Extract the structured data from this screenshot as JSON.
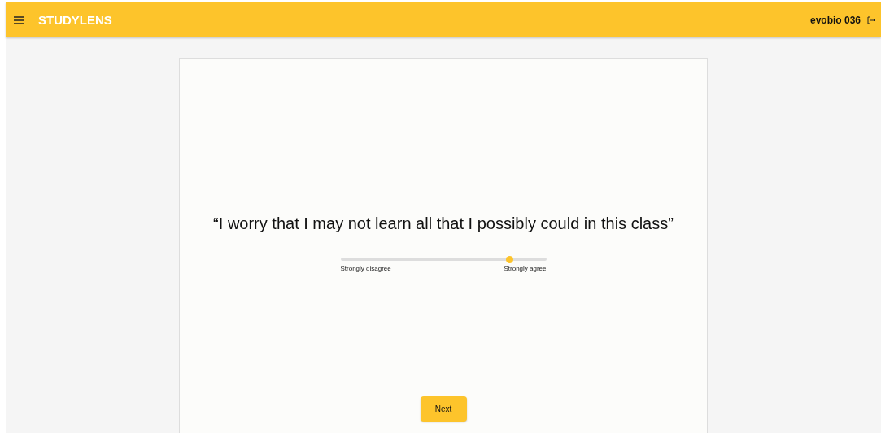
{
  "header": {
    "title": "STUDYLENS",
    "user": "evobio 036"
  },
  "question": {
    "text": "“I worry that I may not learn all that I possibly could in this class”"
  },
  "scale": {
    "level": 0.82,
    "min_label": "Strongly disagree",
    "max_label": "Strongly agree"
  },
  "next_button": {
    "label": "Next"
  }
}
